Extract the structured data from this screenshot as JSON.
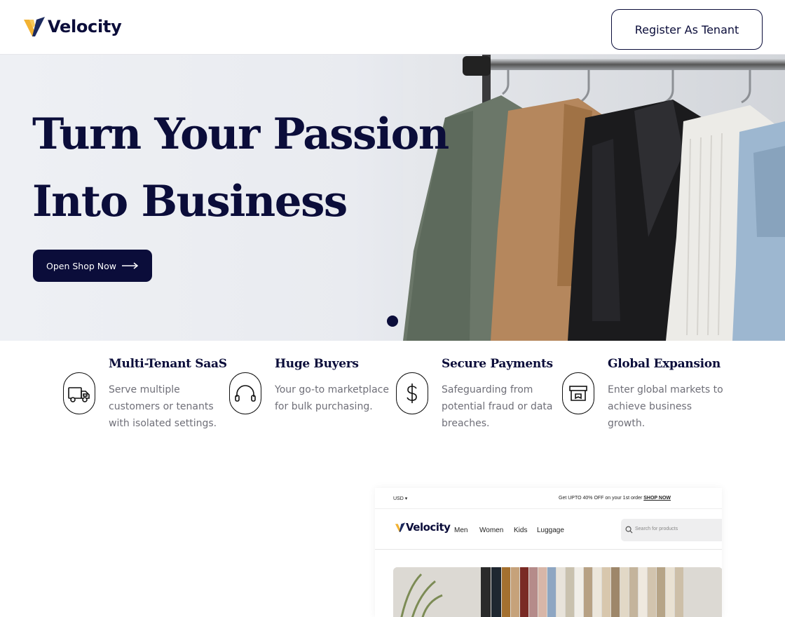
{
  "header": {
    "logo_text": "Velocity",
    "register_label": "Register As Tenant"
  },
  "hero": {
    "title_line1": "Turn Your Passion",
    "title_line2": "Into Business",
    "cta_label": "Open Shop Now",
    "slides_total": 1,
    "active_slide": 1
  },
  "features": [
    {
      "icon": "truck-icon",
      "title": "Multi-Tenant SaaS",
      "description": "Serve multiple customers or tenants with isolated settings."
    },
    {
      "icon": "headphones-icon",
      "title": "Huge Buyers",
      "description": "Your go-to marketplace for bulk purchasing."
    },
    {
      "icon": "dollar-icon",
      "title": "Secure Payments",
      "description": "Safeguarding from potential fraud or data breaches."
    },
    {
      "icon": "store-box-icon",
      "title": "Global Expansion",
      "description": "Enter global markets to achieve business growth."
    }
  ],
  "preview": {
    "currency": "USD",
    "promo_text": "Get UPTO 40% OFF on your 1st order",
    "promo_link": "SHOP NOW",
    "logo_text": "Velocity",
    "menu": [
      "Men",
      "Women",
      "Kids",
      "Luggage"
    ],
    "search_placeholder": "Search for products"
  },
  "colors": {
    "navy": "#0b0d3a",
    "logo_gold": "#f2b233",
    "logo_navy": "#1c2a5e",
    "muted_text": "#6f6f78"
  }
}
